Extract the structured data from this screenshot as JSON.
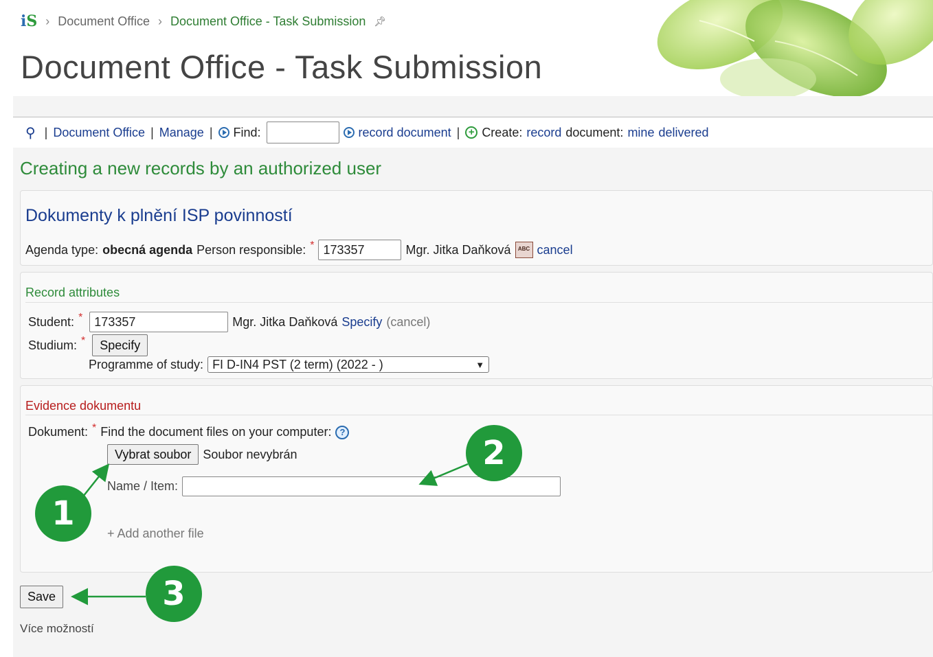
{
  "breadcrumb": {
    "logo": "iS",
    "items": [
      "Document Office",
      "Document Office - Task Submission"
    ]
  },
  "page_title": "Document Office - Task Submission",
  "toolbar": {
    "document_office": "Document Office",
    "manage": "Manage",
    "find_label": "Find:",
    "find_value": "",
    "record_document": "record document",
    "create_label": "Create:",
    "create_record": "record",
    "create_document": "document:",
    "create_mine": "mine",
    "create_delivered": "delivered"
  },
  "section_heading": "Creating a new records by an authorized user",
  "agenda_box": {
    "heading": "Dokumenty k plnění ISP povinností",
    "agenda_type_label": "Agenda type:",
    "agenda_type_value": "obecná agenda",
    "person_label": "Person responsible:",
    "person_value": "173357",
    "person_name": "Mgr. Jitka Daňková",
    "cancel": "cancel"
  },
  "record_attributes": {
    "heading": "Record attributes",
    "student_label": "Student:",
    "student_value": "173357",
    "student_name": "Mgr. Jitka Daňková",
    "specify_link": "Specify",
    "cancel_link": "(cancel)",
    "studium_label": "Studium:",
    "specify_button": "Specify",
    "programme_label": "Programme of study:",
    "programme_value": "FI D-IN4 PST (2 term) (2022 - )"
  },
  "evidence": {
    "heading": "Evidence dokumentu",
    "dokument_label": "Dokument:",
    "find_files_text": "Find the document files on your computer:",
    "choose_file_button": "Vybrat soubor",
    "no_file_text": "Soubor nevybrán",
    "name_item_label": "Name / Item:",
    "name_item_value": "",
    "add_another": "+ Add another file"
  },
  "save_button": "Save",
  "more_options": "Více možností",
  "markers": [
    "1",
    "2",
    "3"
  ],
  "colors": {
    "accent_green": "#219a3b",
    "link_blue": "#1a3d8f",
    "heading_green": "#2e8b3a",
    "heading_red": "#b71c1c"
  }
}
